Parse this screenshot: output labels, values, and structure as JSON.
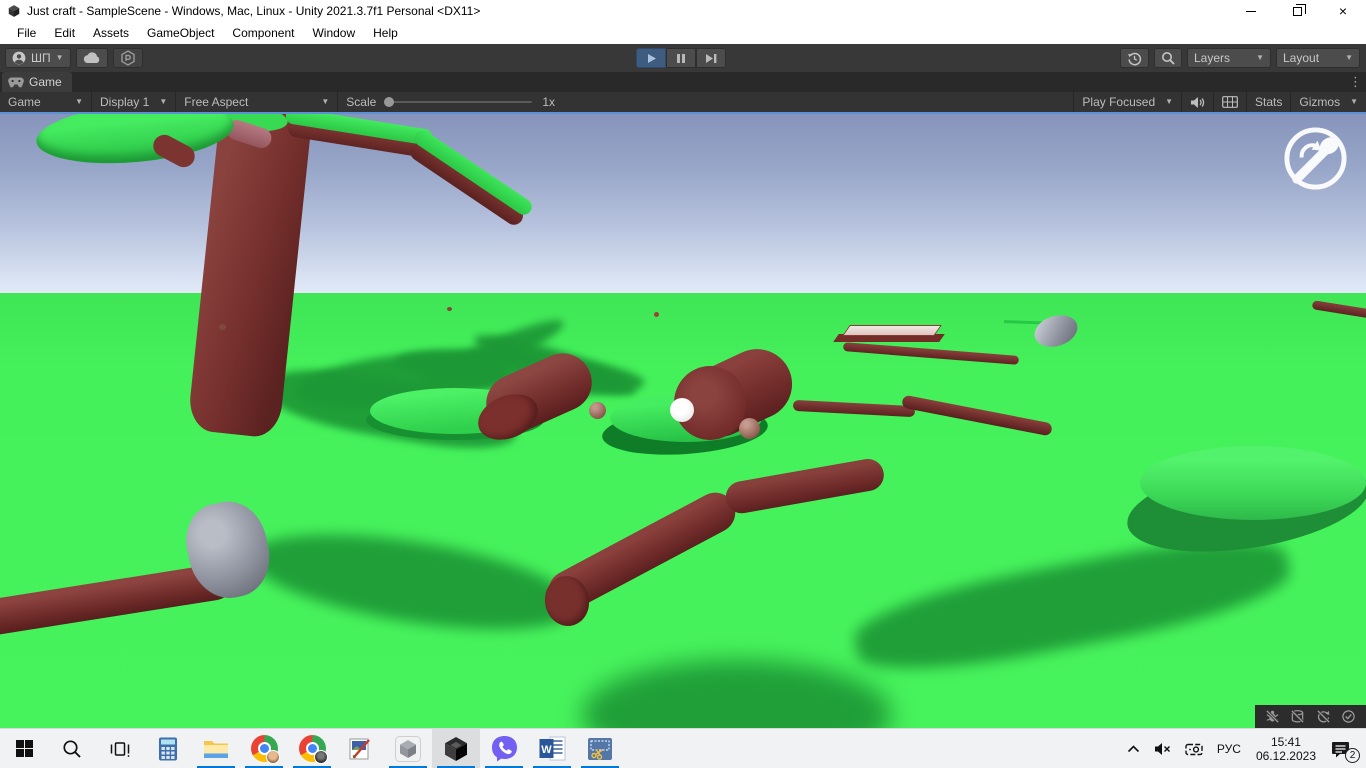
{
  "window": {
    "title": "Just craft - SampleScene - Windows, Mac, Linux - Unity 2021.3.7f1 Personal <DX11>"
  },
  "menubar": {
    "items": [
      "File",
      "Edit",
      "Assets",
      "GameObject",
      "Component",
      "Window",
      "Help"
    ]
  },
  "toolbar": {
    "account_label": "ШП",
    "layers_label": "Layers",
    "layout_label": "Layout",
    "play_state": "playing"
  },
  "tab": {
    "label": "Game"
  },
  "game_toolbar": {
    "view_label": "Game",
    "display_label": "Display 1",
    "aspect_label": "Free Aspect",
    "scale_label": "Scale",
    "scale_value": "1x",
    "focus_label": "Play Focused",
    "stats_label": "Stats",
    "gizmos_label": "Gizmos"
  },
  "scene": {
    "objects": [
      "tree",
      "tree-branches-with-leaves",
      "fallen-logs",
      "sticks",
      "plank",
      "stone-hammer",
      "stone-shovel",
      "wooden-spheres",
      "leaf-piles",
      "white-cursor-dot",
      "rotate-item-hud-icon"
    ],
    "colors": {
      "sky_top": "#8694bc",
      "sky_horizon": "#e2eaf7",
      "ground": "#47f35c",
      "ground_shadow": "#1d9836",
      "wood": "#7b322f",
      "wood_dark": "#5c2422",
      "leaf": "#3ede58",
      "leaf_dark": "#1f8f37",
      "stone": "#8e939f",
      "sphere_brown": "#9c6f63",
      "cursor": "#f5f5f3"
    }
  },
  "status_icons": [
    "debugger-disabled",
    "cache-disabled",
    "auto-refresh-disabled",
    "activity-ok"
  ],
  "taskbar": {
    "apps": [
      "start",
      "search",
      "task-view",
      "calculator",
      "file-explorer",
      "chrome-profile-1",
      "chrome-profile-2",
      "paint",
      "unity-hub",
      "unity-editor",
      "viber",
      "word",
      "snipping-tool"
    ],
    "tray": {
      "language": "РУС",
      "time": "15:41",
      "date": "06.12.2023",
      "notifications": "2"
    }
  }
}
